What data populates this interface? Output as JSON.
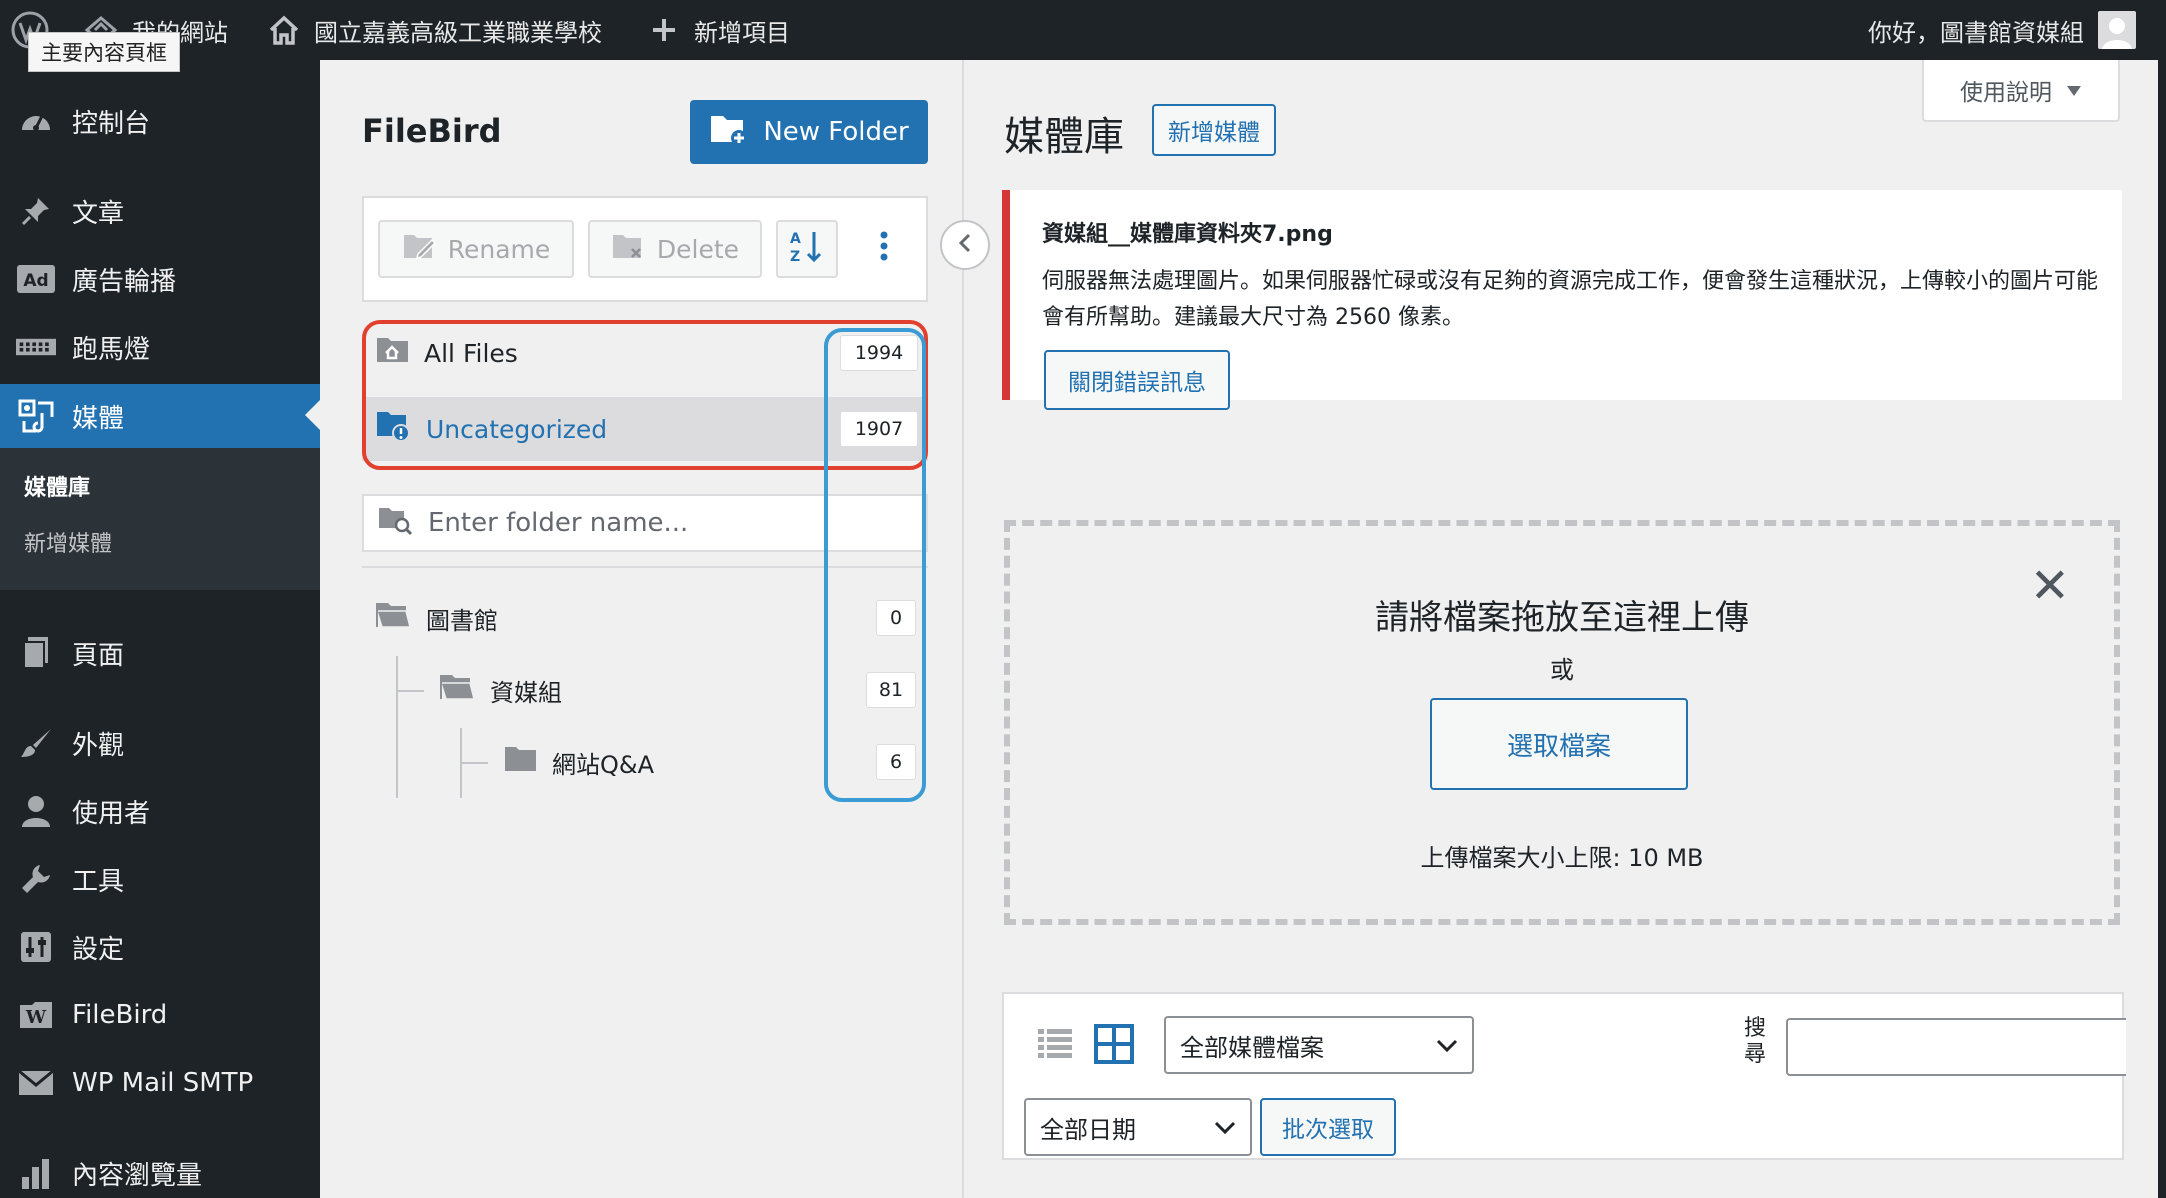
{
  "adminbar": {
    "site_name": "我的網站",
    "school_name": "國立嘉義高級工業職業學校",
    "new_item": "新增項目",
    "greeting": "你好，圖書館資媒組",
    "tooltip": "主要內容頁框"
  },
  "sidebar": {
    "items": [
      {
        "label": "控制台",
        "icon": "dashboard-icon"
      },
      {
        "label": "文章",
        "icon": "pin-icon"
      },
      {
        "label": "廣告輪播",
        "icon": "ad-icon"
      },
      {
        "label": "跑馬燈",
        "icon": "marquee-icon"
      },
      {
        "label": "媒體",
        "icon": "media-icon"
      },
      {
        "label": "頁面",
        "icon": "page-icon"
      },
      {
        "label": "外觀",
        "icon": "brush-icon"
      },
      {
        "label": "使用者",
        "icon": "user-icon"
      },
      {
        "label": "工具",
        "icon": "wrench-icon"
      },
      {
        "label": "設定",
        "icon": "settings-icon"
      },
      {
        "label": "FileBird",
        "icon": "wordpress-icon"
      },
      {
        "label": "WP Mail SMTP",
        "icon": "mail-icon"
      },
      {
        "label": "內容瀏覽量",
        "icon": "bar-chart-icon"
      }
    ],
    "submenu": {
      "library": "媒體庫",
      "add_new": "新增媒體"
    }
  },
  "filebird": {
    "title": "FileBird",
    "new_folder": "New Folder",
    "rename": "Rename",
    "delete": "Delete",
    "all_files": {
      "label": "All Files",
      "count": "1994"
    },
    "uncategorized": {
      "label": "Uncategorized",
      "count": "1907"
    },
    "search_placeholder": "Enter folder name...",
    "tree": [
      {
        "label": "圖書館",
        "count": "0"
      },
      {
        "label": "資媒組",
        "count": "81"
      },
      {
        "label": "網站Q&A",
        "count": "6"
      }
    ]
  },
  "main": {
    "help_tab": "使用說明",
    "page_title": "媒體庫",
    "add_media": "新增媒體",
    "notice": {
      "filename": "資媒組__媒體庫資料夾7.png",
      "message": "伺服器無法處理圖片。如果伺服器忙碌或沒有足夠的資源完成工作，便會發生這種狀況，上傳較小的圖片可能會有所幫助。建議最大尺寸為 2560 像素。",
      "dismiss": "關閉錯誤訊息"
    },
    "upload": {
      "title": "請將檔案拖放至這裡上傳",
      "or": "或",
      "select_files": "選取檔案",
      "limit": "上傳檔案大小上限: 10 MB"
    },
    "filters": {
      "type_filter": "全部媒體檔案",
      "date_filter": "全部日期",
      "bulk_select": "批次選取",
      "search_label": "搜尋"
    }
  },
  "colors": {
    "admin_dark": "#1d2327",
    "primary_blue": "#2271b1",
    "error_red": "#d63638",
    "highlight_red": "#e2402e",
    "highlight_blue": "#3a9bd5"
  }
}
